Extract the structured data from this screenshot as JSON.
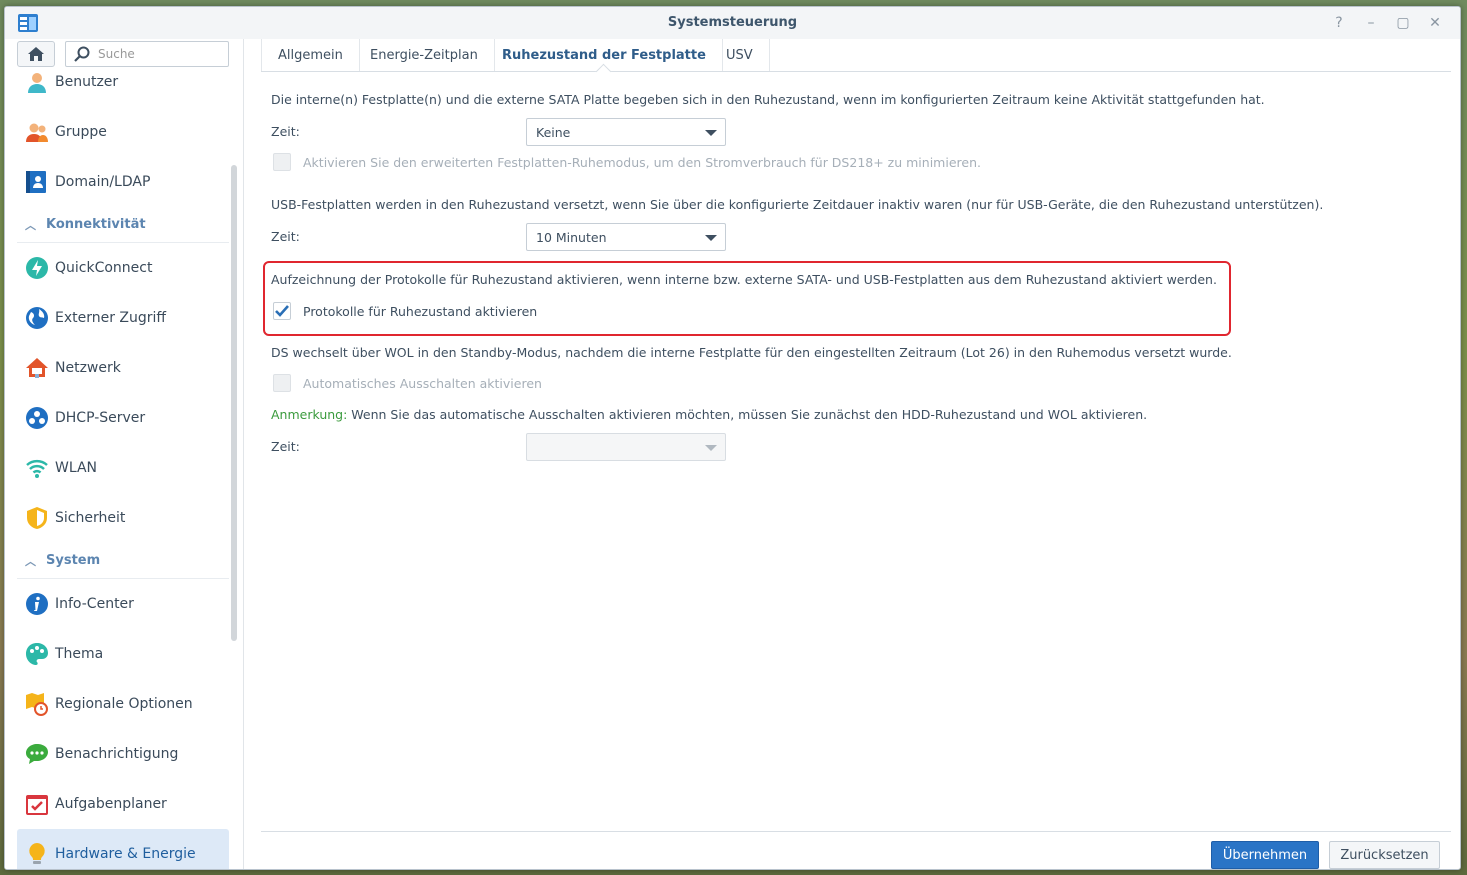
{
  "window": {
    "title": "Systemsteuerung",
    "help": "?",
    "minimize": "–",
    "maximize": "▢",
    "close": "✕"
  },
  "sidebar": {
    "search_placeholder": "Suche",
    "items_top": [
      {
        "label": "Benutzer",
        "icon": "user-icon"
      },
      {
        "label": "Gruppe",
        "icon": "group-icon"
      },
      {
        "label": "Domain/LDAP",
        "icon": "domain-icon"
      }
    ],
    "sections": [
      {
        "title": "Konnektivität",
        "items": [
          {
            "label": "QuickConnect",
            "icon": "quickconnect-icon"
          },
          {
            "label": "Externer Zugriff",
            "icon": "globe-icon"
          },
          {
            "label": "Netzwerk",
            "icon": "network-house-icon"
          },
          {
            "label": "DHCP-Server",
            "icon": "dhcp-icon"
          },
          {
            "label": "WLAN",
            "icon": "wifi-icon"
          },
          {
            "label": "Sicherheit",
            "icon": "shield-icon"
          }
        ]
      },
      {
        "title": "System",
        "items": [
          {
            "label": "Info-Center",
            "icon": "info-icon"
          },
          {
            "label": "Thema",
            "icon": "palette-icon"
          },
          {
            "label": "Regionale Optionen",
            "icon": "regional-clock-icon"
          },
          {
            "label": "Benachrichtigung",
            "icon": "chat-bubble-icon"
          },
          {
            "label": "Aufgabenplaner",
            "icon": "calendar-check-icon"
          },
          {
            "label": "Hardware & Energie",
            "icon": "lightbulb-icon",
            "active": true
          }
        ]
      }
    ]
  },
  "tabs": [
    "Allgemein",
    "Energie-Zeitplan",
    "Ruhezustand der Festplatte",
    "USV"
  ],
  "content": {
    "internal_desc": "Die interne(n) Festplatte(n) und die externe SATA Platte begeben sich in den Ruhezustand, wenn im konfigurierten Zeitraum keine Aktivität stattgefunden hat.",
    "zeit_label": "Zeit:",
    "internal_select": "Keine",
    "advanced_mode_label": "Aktivieren Sie den erweiterten Festplatten-Ruhemodus, um den Stromverbrauch für DS218+ zu minimieren.",
    "usb_desc": "USB-Festplatten werden in den Ruhezustand versetzt, wenn Sie über die konfigurierte Zeitdauer inaktiv waren (nur für USB-Geräte, die den Ruhezustand unterstützen).",
    "usb_select": "10 Minuten",
    "log_desc": "Aufzeichnung der Protokolle für Ruhezustand aktivieren, wenn interne bzw. externe SATA- und USB-Festplatten aus dem Ruhezustand aktiviert werden.",
    "log_checkbox_label": "Protokolle für Ruhezustand aktivieren",
    "wol_desc": "DS wechselt über WOL in den Standby-Modus, nachdem die interne Festplatte für den eingestellten Zeitraum (Lot 26) in den Ruhemodus versetzt wurde.",
    "auto_off_label": "Automatisches Ausschalten aktivieren",
    "note_key": "Anmerkung:",
    "note_text": " Wenn Sie das automatische Ausschalten aktivieren möchten, müssen Sie zunächst den HDD-Ruhezustand und WOL aktivieren.",
    "auto_off_select": ""
  },
  "footer": {
    "apply": "Übernehmen",
    "reset": "Zurücksetzen"
  },
  "colors": {
    "accent": "#2a74c6",
    "highlight": "#e0262f",
    "note": "#3b9b3e"
  }
}
